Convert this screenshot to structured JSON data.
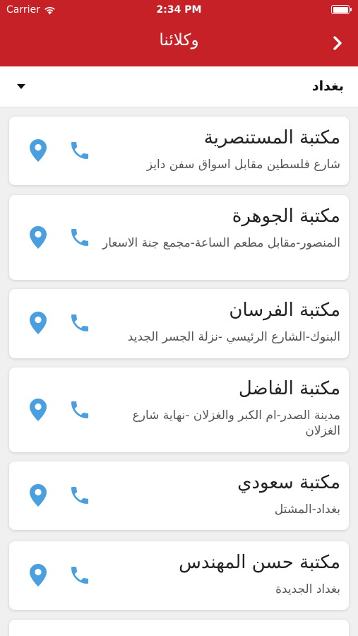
{
  "status_bar": {
    "carrier": "Carrier",
    "time": "2:34 PM"
  },
  "nav": {
    "title": "وكلائنا"
  },
  "filter": {
    "selected_city": "بغداد"
  },
  "colors": {
    "brand": "#c52127",
    "icon": "#4a9fe0"
  },
  "agents": [
    {
      "name": "مكتبة المستنصرية",
      "address": "شارع فلسطين مقابل اسواق سفن دايز"
    },
    {
      "name": "مكتبة الجوهرة",
      "address": "المنصور-مقابل مطعم الساعة-مجمع جنة الاسعار"
    },
    {
      "name": "مكتبة الفرسان",
      "address": "البنوك-الشارع الرئيسي -نزلة الجسر الجديد"
    },
    {
      "name": "مكتبة الفاضل",
      "address": "مدينة الصدر-ام الكبر والغزلان -نهاية شارع الغزلان"
    },
    {
      "name": "مكتبة سعودي",
      "address": "بغداد-المشتل"
    },
    {
      "name": "مكتبة حسن المهندس",
      "address": "بغداد الجديدة"
    }
  ]
}
